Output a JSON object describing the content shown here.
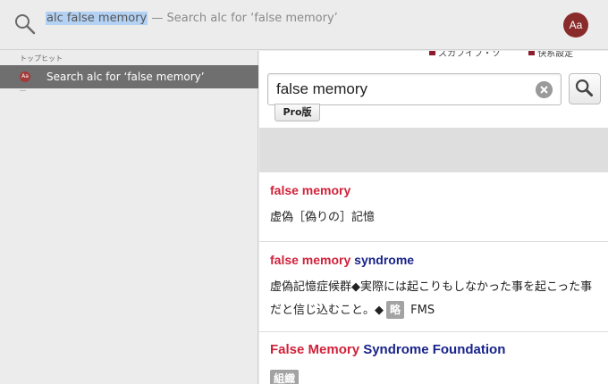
{
  "search": {
    "query": "alc false memory",
    "hint": " — Search alc for ‘false memory’",
    "app_icon_label": "Aa"
  },
  "results": {
    "section_label": "トップヒット",
    "items": [
      {
        "icon": "dictionary-icon",
        "label": "Search alc for ‘false memory’",
        "selected": true
      }
    ]
  },
  "preview": {
    "top_links": [
      "スカフイフ・ソ",
      "快系設定"
    ],
    "input_value": "false memory",
    "pro_label": "Pro版",
    "entries": [
      {
        "head": [
          {
            "text": "false memory",
            "style": "red"
          }
        ],
        "definition": "虚偽［偽りの］記憶"
      },
      {
        "head": [
          {
            "text": "false memory",
            "style": "red"
          },
          {
            "text": " syndrome",
            "style": "blue"
          }
        ],
        "definition_1": "虚偽記憶症候群◆実際には起こりもしなかった事を起こった事だと信じ込むこと。◆",
        "abbr_tag": "略",
        "definition_2": "FMS"
      },
      {
        "head": [
          {
            "text": "False Memory",
            "style": "red"
          },
          {
            "text": " Syndrome Foundation",
            "style": "blue"
          }
        ],
        "tag": "組織"
      }
    ]
  },
  "colors": {
    "red": "#d0223a",
    "blue": "#18238a",
    "selection": "#6f6f6f",
    "highlight": "#b3d1f3"
  }
}
